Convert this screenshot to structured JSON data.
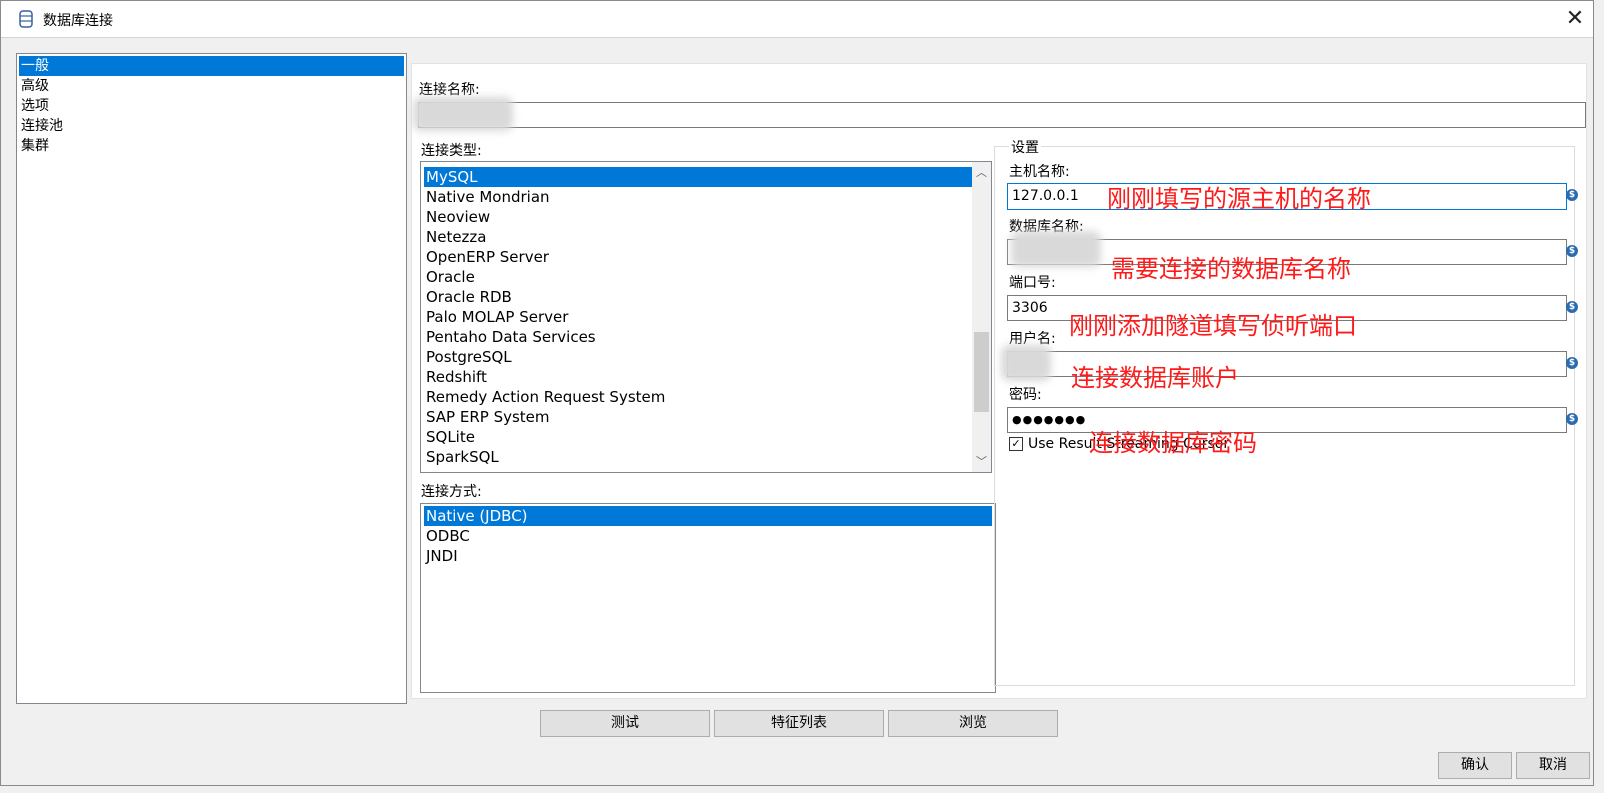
{
  "window": {
    "title": "数据库连接",
    "close_symbol": "✕"
  },
  "nav": {
    "items": [
      {
        "label": "一般",
        "selected": true
      },
      {
        "label": "高级",
        "selected": false
      },
      {
        "label": "选项",
        "selected": false
      },
      {
        "label": "连接池",
        "selected": false
      },
      {
        "label": "集群",
        "selected": false
      }
    ]
  },
  "form": {
    "connection_name_label": "连接名称:",
    "connection_type_label": "连接类型:",
    "connection_types": [
      "MySQL",
      "Native Mondrian",
      "Neoview",
      "Netezza",
      "OpenERP Server",
      "Oracle",
      "Oracle RDB",
      "Palo MOLAP Server",
      "Pentaho Data Services",
      "PostgreSQL",
      "Redshift",
      "Remedy Action Request System",
      "SAP ERP System",
      "SQLite",
      "SparkSQL"
    ],
    "selected_type": "MySQL",
    "access_label": "连接方式:",
    "access_types": [
      "Native (JDBC)",
      "ODBC",
      "JNDI"
    ],
    "selected_access": "Native (JDBC)"
  },
  "settings": {
    "group_label": "设置",
    "host_label": "主机名称:",
    "host_value": "127.0.0.1",
    "db_label": "数据库名称:",
    "port_label": "端口号:",
    "port_value": "3306",
    "user_label": "用户名:",
    "password_label": "密码:",
    "password_value": "●●●●●●●",
    "streaming_label": "Use Result Streaming Cursor",
    "streaming_checked": true,
    "variable_icon_symbol": "$"
  },
  "annotations": {
    "host": "刚刚填写的源主机的名称",
    "db": "需要连接的数据库名称",
    "port": "刚刚添加隧道填写侦听端口",
    "user": "连接数据库账户",
    "password": "连接数据库密码"
  },
  "buttons": {
    "test": "测试",
    "features": "特征列表",
    "browse": "浏览",
    "ok": "确认",
    "cancel": "取消"
  },
  "colors": {
    "selection": "#0078d7",
    "annotation": "#ff1a1a",
    "variable_icon": "#2b6cb0"
  }
}
